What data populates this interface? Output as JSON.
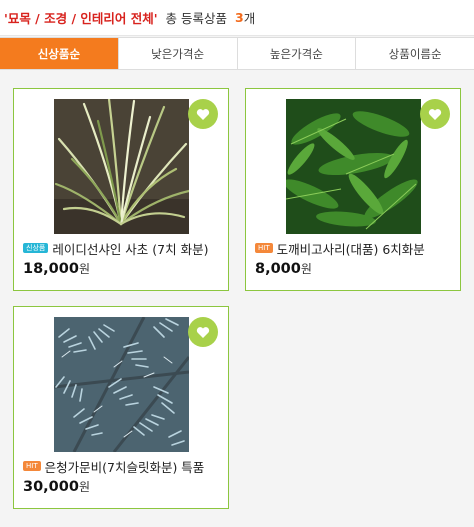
{
  "header": {
    "category": "'묘목 / 조경 / 인테리어 전체'",
    "total_label": "총 등록상품",
    "count": "3",
    "unit": "개"
  },
  "tabs": [
    {
      "label": "신상품순",
      "active": true
    },
    {
      "label": "낮은가격순",
      "active": false
    },
    {
      "label": "높은가격순",
      "active": false
    },
    {
      "label": "상품이름순",
      "active": false
    }
  ],
  "products": [
    {
      "badge": "신상품",
      "badge_type": "new",
      "name": "레이디선샤인 사초 (7치 화분)",
      "price": "18,000",
      "currency": "원",
      "wish_icon": "heart-icon"
    },
    {
      "badge": "HIT",
      "badge_type": "hit",
      "name": "도깨비고사리(대품) 6치화분",
      "price": "8,000",
      "currency": "원",
      "wish_icon": "heart-icon"
    },
    {
      "badge": "HIT",
      "badge_type": "hit",
      "name": "은청가문비(7치슬릿화분) 특품",
      "price": "30,000",
      "currency": "원",
      "wish_icon": "heart-icon"
    }
  ],
  "colors": {
    "accent": "#f47b1e",
    "category_red": "#d8231e",
    "card_border": "#8cc63f",
    "heart_bg": "#a8d14a",
    "badge_new": "#26b6d6",
    "badge_hit": "#f4883a"
  }
}
